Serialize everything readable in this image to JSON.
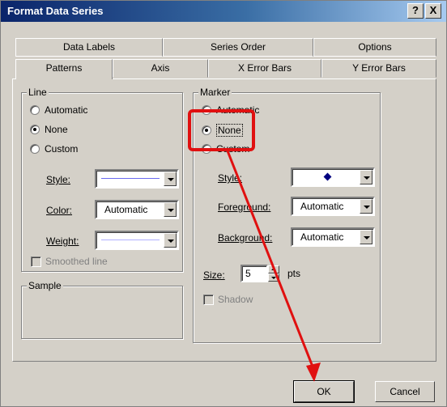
{
  "dialog": {
    "title": "Format Data Series",
    "help_label": "?",
    "close_label": "X"
  },
  "tabs": {
    "back_row": [
      "Data Labels",
      "Series Order",
      "Options"
    ],
    "front_row": [
      "Patterns",
      "Axis",
      "X Error Bars",
      "Y Error Bars"
    ],
    "active": "Patterns"
  },
  "line_group": {
    "label": "Line",
    "options": [
      {
        "label": "Automatic",
        "checked": false
      },
      {
        "label": "None",
        "checked": true
      },
      {
        "label": "Custom",
        "checked": false
      }
    ],
    "style_label": "Style:",
    "color_label": "Color:",
    "color_value": "Automatic",
    "weight_label": "Weight:",
    "smoothed_label": "Smoothed line"
  },
  "sample_group": {
    "label": "Sample"
  },
  "marker_group": {
    "label": "Marker",
    "options": [
      {
        "label": "Automatic",
        "checked": false
      },
      {
        "label": "None",
        "checked": true
      },
      {
        "label": "Custom",
        "checked": false
      }
    ],
    "style_label": "Style:",
    "foreground_label": "Foreground:",
    "foreground_value": "Automatic",
    "background_label": "Background:",
    "background_value": "Automatic",
    "size_label": "Size:",
    "size_value": "5",
    "size_unit": "pts",
    "shadow_label": "Shadow"
  },
  "buttons": {
    "ok": "OK",
    "cancel": "Cancel"
  },
  "colors": {
    "highlight": "#e01010",
    "marker_diamond": "#000080"
  }
}
